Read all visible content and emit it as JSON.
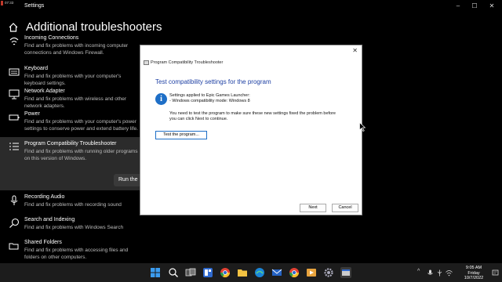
{
  "titlebar": {
    "clock": "07:33",
    "title": "Settings",
    "minimize": "–",
    "maximize": "☐",
    "close": "✕"
  },
  "page": {
    "title": "Additional troubleshooters"
  },
  "troubleshooters": [
    {
      "name": "Incoming Connections",
      "desc": "Find and fix problems with incoming computer connections and Windows Firewall.",
      "icon": "network-icon"
    },
    {
      "name": "Keyboard",
      "desc": "Find and fix problems with your computer's keyboard settings.",
      "icon": "keyboard-icon"
    },
    {
      "name": "Network Adapter",
      "desc": "Find and fix problems with wireless and other network adapters.",
      "icon": "network-adapter-icon"
    },
    {
      "name": "Power",
      "desc": "Find and fix problems with your computer's power settings to conserve power and extend battery life.",
      "icon": "battery-icon"
    },
    {
      "name": "Program Compatibility Troubleshooter",
      "desc": "Find and fix problems with running older programs on this version of Windows.",
      "icon": "list-icon"
    },
    {
      "name": "Recording Audio",
      "desc": "Find and fix problems with recording sound",
      "icon": "microphone-icon"
    },
    {
      "name": "Search and Indexing",
      "desc": "Find and fix problems with Windows Search",
      "icon": "search-icon"
    },
    {
      "name": "Shared Folders",
      "desc": "Find and fix problems with accessing files and folders on other computers.",
      "icon": "folder-share-icon"
    }
  ],
  "run_button": "Run the",
  "dialog": {
    "window_title": "Program Compatibility Troubleshooter",
    "close": "✕",
    "heading": "Test compatibility settings for the program",
    "settings_line1": "Settings applied to Epic Games Launcher:",
    "settings_line2": "- Windows compatibility mode: Windows 8",
    "instruction_line1": "You need to test the program to make sure these new settings fixed the problem before",
    "instruction_line2": "you can click Next to continue.",
    "test_button": "Test the program...",
    "next_button": "Next",
    "cancel_button": "Cancel"
  },
  "taskbar": {
    "apps": [
      "windows-start-icon",
      "search-icon",
      "task-view-icon",
      "widgets-icon",
      "chrome-icon",
      "file-explorer-icon",
      "edge-icon",
      "mail-icon",
      "chrome-icon",
      "media-player-icon",
      "settings-icon",
      "troubleshooter-icon"
    ],
    "tray_chevron": "^",
    "time": "9:05 AM",
    "day": "Friday",
    "date": "10/7/2022"
  },
  "colors": {
    "accent": "#1e6fc7",
    "heading_blue": "#1d3fa3",
    "background": "#000000",
    "taskbar": "#1c1c1c"
  }
}
